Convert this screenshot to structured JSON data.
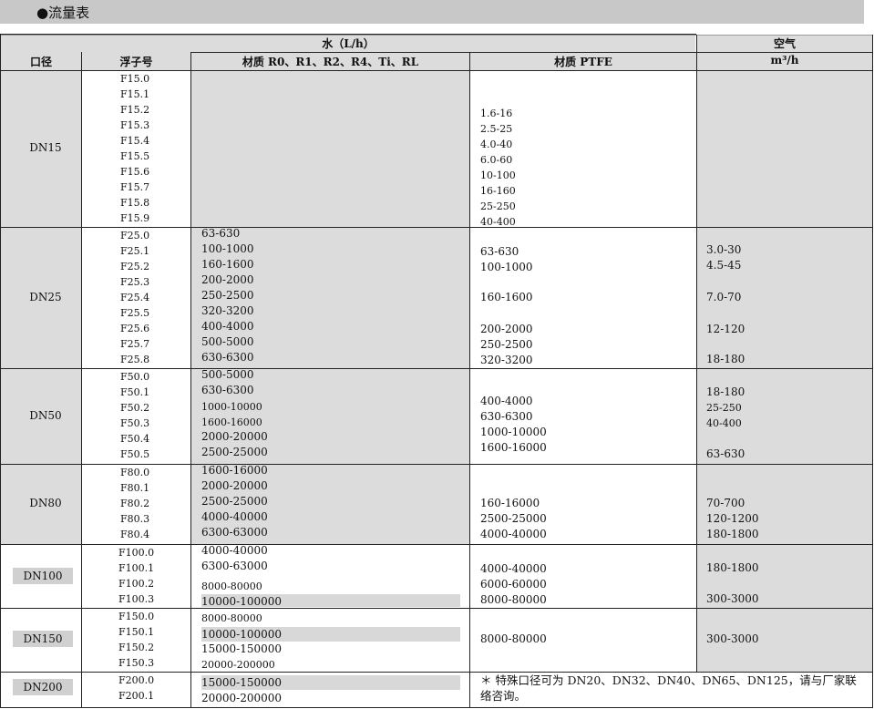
{
  "section_title": "●流量表",
  "header": {
    "water": "水（L/h）",
    "air": "空气",
    "col_dn": "口径",
    "col_float": "浮子号",
    "col_mat1": "材质 R0、R1、R2、R4、Ti、RL",
    "col_ptfe": "材质 PTFE",
    "col_air_unit": "m³/h"
  },
  "groups": [
    {
      "dn": "DN15",
      "floats": [
        "F15.0",
        "F15.1",
        "F15.2",
        "F15.3",
        "F15.4",
        "F15.5",
        "F15.6",
        "F15.7",
        "F15.8",
        "F15.9"
      ],
      "mat1": [],
      "ptfe": [
        "1.6-16",
        "2.5-25",
        "4.0-40",
        "6.0-60",
        "10-100",
        "16-160",
        "25-250",
        "40-400"
      ],
      "air": []
    },
    {
      "dn": "DN25",
      "floats": [
        "F25.0",
        "F25.1",
        "F25.2",
        "F25.3",
        "F25.4",
        "F25.5",
        "F25.6",
        "F25.7",
        "F25.8"
      ],
      "mat1": [
        "63-630",
        "100-1000",
        "160-1600",
        "200-2000",
        "250-2500",
        "320-3200",
        "400-4000",
        "500-5000",
        "630-6300"
      ],
      "ptfe": [
        "63-630",
        "100-1000",
        "160-1600",
        "200-2000",
        "250-2500",
        "320-3200"
      ],
      "air": [
        "3.0-30",
        "4.5-45",
        "7.0-70",
        "12-120",
        "18-180"
      ]
    },
    {
      "dn": "DN50",
      "floats": [
        "F50.0",
        "F50.1",
        "F50.2",
        "F50.3",
        "F50.4",
        "F50.5"
      ],
      "mat1": [
        "500-5000",
        "630-6300",
        "1000-10000",
        "1600-16000",
        "2000-20000",
        "2500-25000"
      ],
      "ptfe": [
        "400-4000",
        "630-6300",
        "1000-10000",
        "1600-16000"
      ],
      "air": [
        "18-180",
        "25-250",
        "40-400",
        "63-630"
      ]
    },
    {
      "dn": "DN80",
      "floats": [
        "F80.0",
        "F80.1",
        "F80.2",
        "F80.3",
        "F80.4"
      ],
      "mat1": [
        "1600-16000",
        "2000-20000",
        "2500-25000",
        "4000-40000",
        "6300-63000"
      ],
      "ptfe": [
        "160-16000",
        "2500-25000",
        "4000-40000"
      ],
      "air": [
        "70-700",
        "120-1200",
        "180-1800"
      ]
    },
    {
      "dn": "DN100",
      "floats": [
        "F100.0",
        "F100.1",
        "F100.2",
        "F100.3"
      ],
      "mat1": [
        "4000-40000",
        "6300-63000",
        "8000-80000",
        "10000-100000"
      ],
      "ptfe": [
        "4000-40000",
        "6000-60000",
        "8000-80000"
      ],
      "air": [
        "180-1800",
        "300-3000"
      ]
    },
    {
      "dn": "DN150",
      "floats": [
        "F150.0",
        "F150.1",
        "F150.2",
        "F150.3"
      ],
      "mat1": [
        "8000-80000",
        "10000-100000",
        "15000-150000",
        "20000-200000"
      ],
      "ptfe": [
        "8000-80000"
      ],
      "air": [
        "300-3000"
      ]
    },
    {
      "dn": "DN200",
      "floats": [
        "F200.0",
        "F200.1"
      ],
      "mat1": [
        "15000-150000",
        "20000-200000"
      ],
      "note": "＊ 特殊口径可为 DN20、DN32、DN40、DN65、DN125，请与厂家联络咨询。"
    }
  ],
  "colors": {
    "title_bar": "#c8c8c8",
    "cell_gray": "#dcdcdc",
    "dn_box": "#d0d0d0"
  }
}
